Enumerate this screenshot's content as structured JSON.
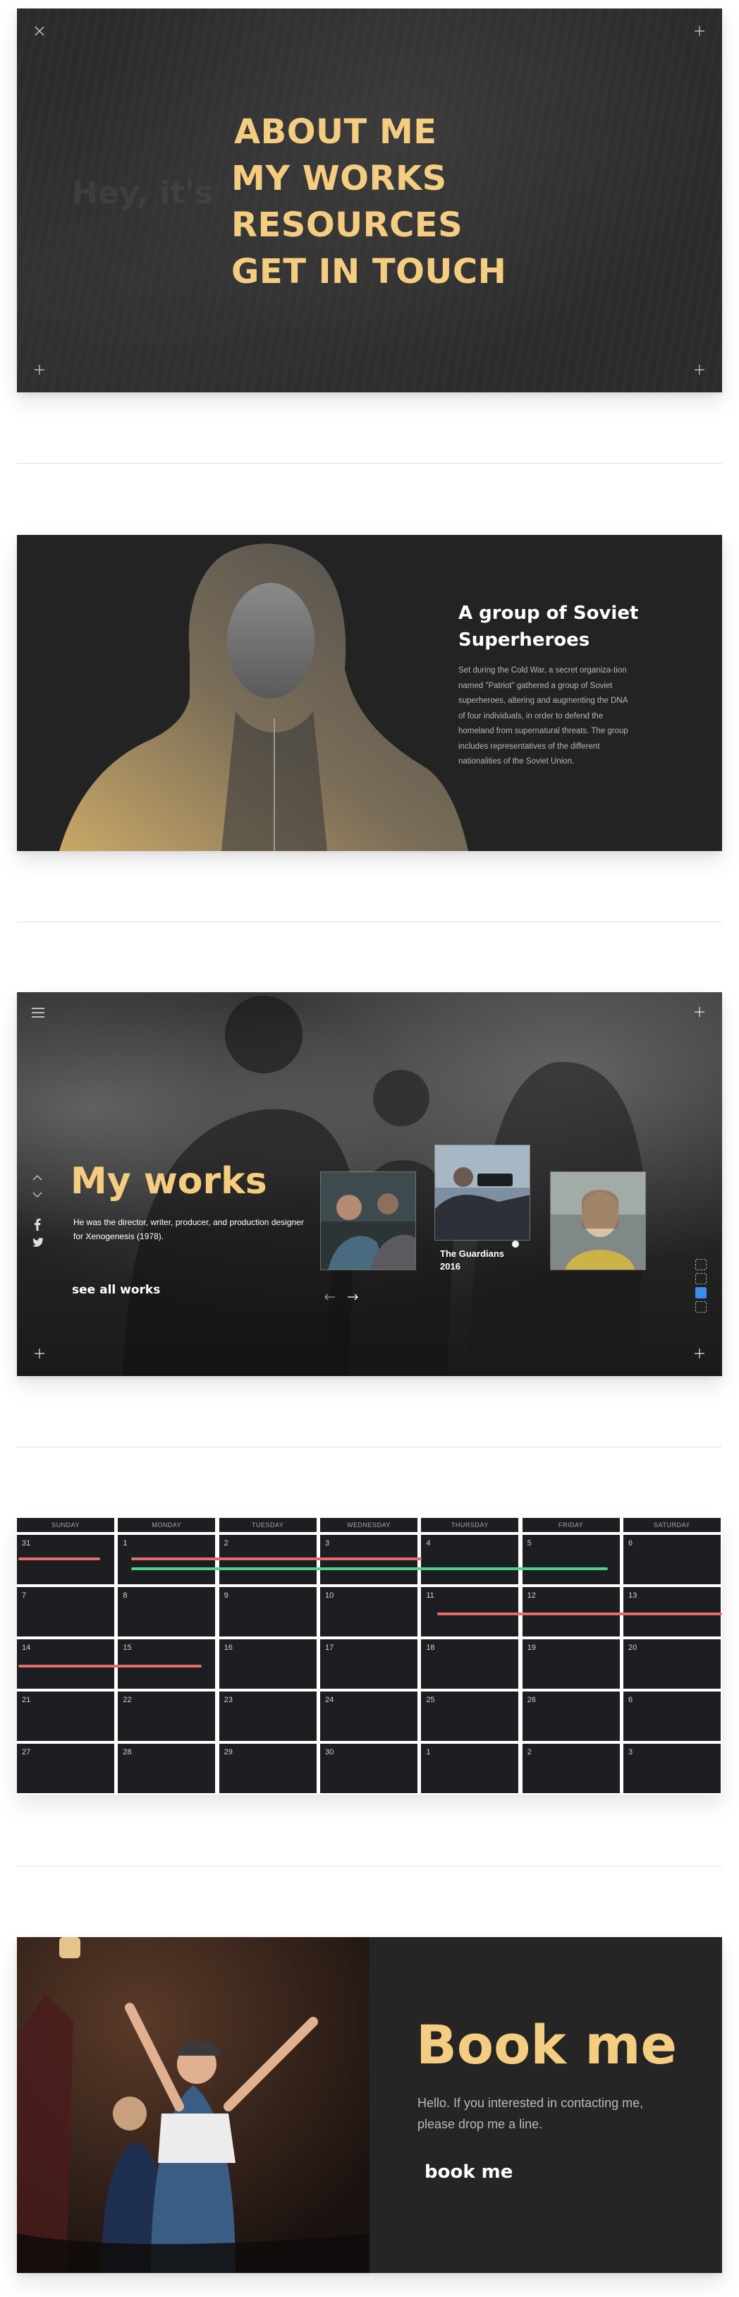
{
  "menu_panel": {
    "ghost_text": "Hey, it's",
    "items": [
      "ABOUT ME",
      "MY WORKS",
      "RESOURCES",
      "GET IN TOUCH"
    ],
    "icons": [
      "close-icon",
      "plus-icon"
    ]
  },
  "hero_panel": {
    "title": "A group of Soviet Superheroes",
    "body": "Set during the Cold War, a secret organiza-tion named \"Patriot\" gathered a group of Soviet superheroes, altering and augmenting the DNA of four individuals, in order to defend the homeland from supernatural threats. The group includes representatives of the different nationalities of the Soviet Union."
  },
  "works_panel": {
    "title": "My works",
    "description": "He was the director, writer, producer, and production designer for Xenogenesis (1978).",
    "cta": "see all works",
    "featured_caption_line1": "The Guardians",
    "featured_caption_line2": "2016",
    "icons": [
      "menu-icon",
      "plus-icon",
      "chevron-up-icon",
      "chevron-down-icon",
      "facebook-icon",
      "twitter-icon",
      "arrow-left-icon",
      "arrow-right-icon"
    ]
  },
  "calendar": {
    "days": [
      "SUNDAY",
      "MONDAY",
      "TUESDAY",
      "WEDNESDAY",
      "THURSDAY",
      "FRIDAY",
      "SATURDAY"
    ],
    "weeks": [
      [
        "31",
        "1",
        "2",
        "3",
        "4",
        "5",
        "6"
      ],
      [
        "7",
        "8",
        "9",
        "10",
        "11",
        "12",
        "13"
      ],
      [
        "14",
        "15",
        "16",
        "17",
        "18",
        "19",
        "20"
      ],
      [
        "21",
        "22",
        "23",
        "24",
        "25",
        "26",
        "6"
      ],
      [
        "27",
        "28",
        "29",
        "30",
        "1",
        "2",
        "3"
      ]
    ],
    "event_colors": {
      "red": "#e86a6a",
      "green": "#4fd18b"
    }
  },
  "book_panel": {
    "title": "Book me",
    "text": "Hello. If you interested in contacting me, please drop me a line.",
    "cta": "book me"
  },
  "colors": {
    "accent": "#f5cd81",
    "link_underline": "#2a80e3",
    "panel": "#232324"
  }
}
